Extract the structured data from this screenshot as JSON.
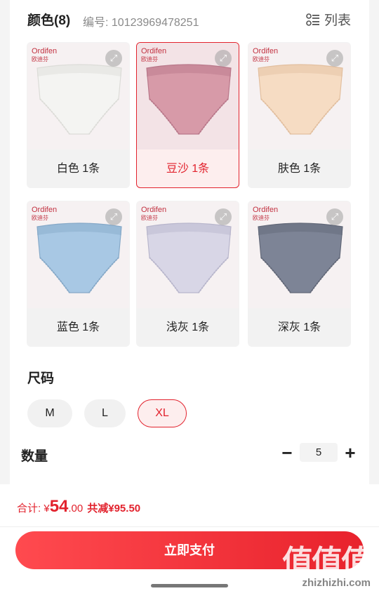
{
  "header": {
    "title": "颜色(8)",
    "code": "编号: 10123969478251",
    "list_label": "列表"
  },
  "brand": {
    "name": "Ordifen",
    "sub": "欧迪芬"
  },
  "colors": [
    {
      "label": "白色 1条",
      "fill": "#f4f4f2",
      "shade": "#dcdcd8",
      "selected": false
    },
    {
      "label": "豆沙 1条",
      "fill": "#d79aa8",
      "shade": "#b9788a",
      "selected": true
    },
    {
      "label": "肤色 1条",
      "fill": "#f6dcc3",
      "shade": "#e2bf9f",
      "selected": false
    },
    {
      "label": "蓝色 1条",
      "fill": "#a8c8e4",
      "shade": "#86a9c8",
      "selected": false
    },
    {
      "label": "浅灰 1条",
      "fill": "#d8d6e6",
      "shade": "#b8b6cc",
      "selected": false
    },
    {
      "label": "深灰 1条",
      "fill": "#7d8496",
      "shade": "#626878",
      "selected": false
    }
  ],
  "size": {
    "title": "尺码",
    "options": [
      "M",
      "L",
      "XL"
    ],
    "selected": "XL"
  },
  "quantity": {
    "label": "数量",
    "minus": "−",
    "value": "5",
    "plus": "+"
  },
  "footer": {
    "total_prefix": "合计: ¥",
    "total_big": "54",
    "total_cents": ".00",
    "savings": "共减¥95.50",
    "pay_label": "立即支付",
    "watermark": "值值值",
    "watermark_sub": "zhizhizhi.com"
  },
  "accent": "#e2222d"
}
